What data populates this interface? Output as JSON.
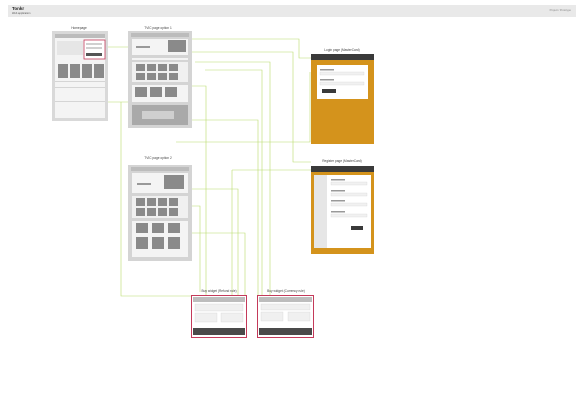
{
  "header": {
    "title": "Tonkr",
    "subtitle": "Web application",
    "right": "Project / Prototype"
  },
  "frames": {
    "homepage": {
      "label": "Homepage"
    },
    "tvc1": {
      "label": "TVIC page option 1"
    },
    "tvc2": {
      "label": "TVIC page option 2"
    },
    "login": {
      "label": "Login page (MasterCard)"
    },
    "register": {
      "label": "Register page (MasterCard)"
    },
    "buy_refund": {
      "label": "Buy widget (Refund rule)"
    },
    "buy_currency": {
      "label": "Buy widget (Currency rule)"
    }
  },
  "colors": {
    "accent": "#d4931c",
    "link": "#b8dc6a",
    "widget_border": "#c43a5a",
    "wire": "#c9c9c9",
    "block": "#8a8a8a"
  }
}
